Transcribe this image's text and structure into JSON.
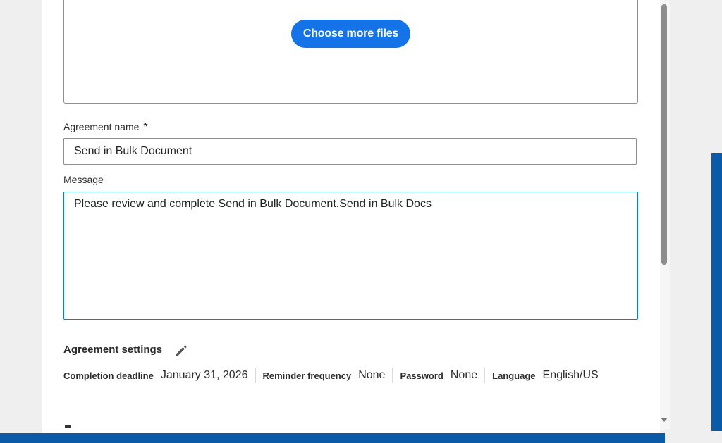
{
  "upload": {
    "choose_button_label": "Choose more files"
  },
  "agreement_name": {
    "label": "Agreement name",
    "required_marker": "*",
    "value": "Send in Bulk Document"
  },
  "message": {
    "label": "Message",
    "value": "Please review and complete Send in Bulk Document.Send in Bulk Docs"
  },
  "agreement_settings": {
    "title": "Agreement settings",
    "edit_icon": "pencil-icon",
    "items": [
      {
        "label": "Completion deadline",
        "value": "January 31, 2026"
      },
      {
        "label": "Reminder frequency",
        "value": "None"
      },
      {
        "label": "Password",
        "value": "None"
      },
      {
        "label": "Language",
        "value": "English/US"
      }
    ]
  },
  "colors": {
    "accent": "#1473e6",
    "frame_blue": "#0a5aa8"
  }
}
